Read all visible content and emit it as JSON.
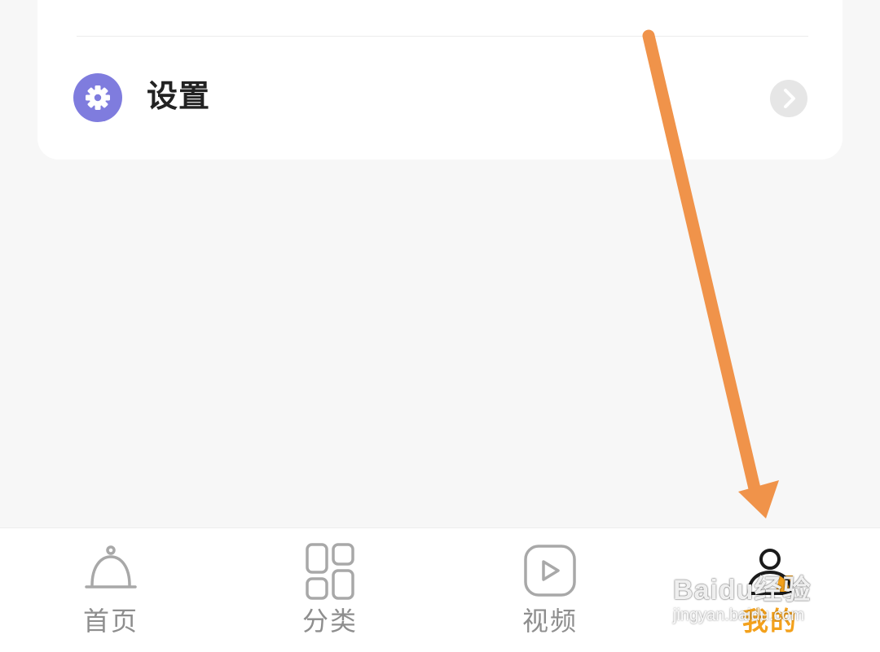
{
  "settings_card": {
    "settings_item": {
      "label": "设置",
      "icon": "gear-icon",
      "trailing_icon": "chevron-right-icon"
    }
  },
  "tab_bar": {
    "active_index": 3,
    "tabs": [
      {
        "label": "首页",
        "icon": "bell-cloche-icon"
      },
      {
        "label": "分类",
        "icon": "category-grid-icon"
      },
      {
        "label": "视频",
        "icon": "video-play-icon"
      },
      {
        "label": "我的",
        "icon": "profile-icon"
      }
    ]
  },
  "colors": {
    "accent": "#f3a11c",
    "settings_icon_bg": "#7f7cde",
    "annotation_arrow": "#f0934a",
    "page_bg": "#f7f7f7"
  },
  "watermark": {
    "brand": "Baidu",
    "brand_suffix": "经验",
    "url": "jingyan.baidu.com"
  }
}
